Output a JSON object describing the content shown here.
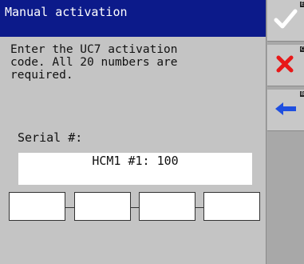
{
  "title": "Manual activation",
  "instructions": "Enter the UC7 activation\ncode. All 20 numbers are\nrequired.",
  "serial": {
    "label": "Serial #:",
    "value": "HCM1 #1: 100"
  },
  "code_fields": [
    {
      "value": ""
    },
    {
      "value": ""
    },
    {
      "value": ""
    },
    {
      "value": ""
    }
  ],
  "sidebar": [
    {
      "icon": "checkmark-icon",
      "hotkey": "E",
      "color": "#ffffff"
    },
    {
      "icon": "close-icon",
      "hotkey": "C",
      "color": "#e81818"
    },
    {
      "icon": "back-arrow-icon",
      "hotkey": "B",
      "color": "#1f4fe0"
    }
  ],
  "colors": {
    "title_bg": "#0c1a8a",
    "panel_bg": "#c4c4c4",
    "sidebar_bg": "#a8a8a8"
  }
}
